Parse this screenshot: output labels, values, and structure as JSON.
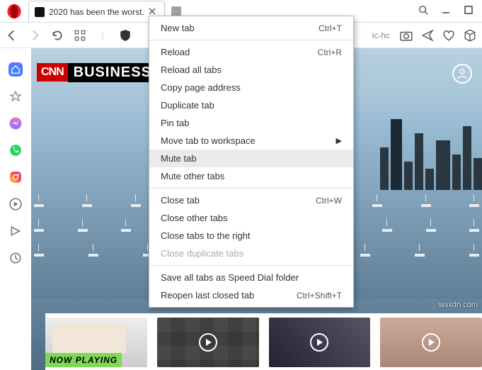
{
  "titlebar": {
    "tabs": [
      {
        "label": "2020 has been the worst."
      },
      {
        "label": ""
      }
    ]
  },
  "toolbar": {
    "url_tail": "ic-hc"
  },
  "banner": {
    "cnn": "CNN",
    "business": "BUSINESS"
  },
  "context_menu": {
    "items": [
      {
        "label": "New tab",
        "shortcut": "Ctrl+T"
      },
      {
        "sep": true
      },
      {
        "label": "Reload",
        "shortcut": "Ctrl+R"
      },
      {
        "label": "Reload all tabs"
      },
      {
        "label": "Copy page address"
      },
      {
        "label": "Duplicate tab"
      },
      {
        "label": "Pin tab"
      },
      {
        "label": "Move tab to workspace",
        "submenu": true
      },
      {
        "label": "Mute tab",
        "highlight": true
      },
      {
        "label": "Mute other tabs"
      },
      {
        "sep": true
      },
      {
        "label": "Close tab",
        "shortcut": "Ctrl+W"
      },
      {
        "label": "Close other tabs"
      },
      {
        "label": "Close tabs to the right"
      },
      {
        "label": "Close duplicate tabs",
        "disabled": true
      },
      {
        "sep": true
      },
      {
        "label": "Save all tabs as Speed Dial folder"
      },
      {
        "label": "Reopen last closed tab",
        "shortcut": "Ctrl+Shift+T"
      }
    ]
  },
  "thumbs": {
    "now_playing": "NOW PLAYING"
  },
  "watermark": "wsxdn.com"
}
